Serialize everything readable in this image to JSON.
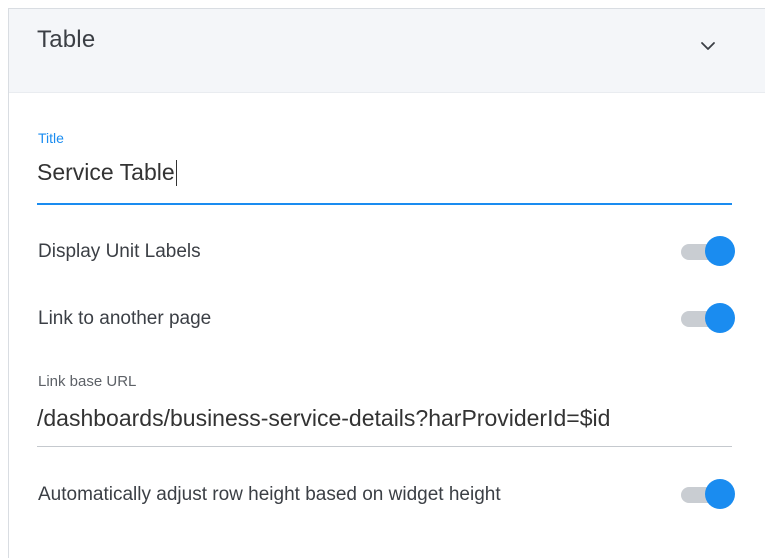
{
  "panel": {
    "title": "Table",
    "collapse_icon": "chevron-down-icon"
  },
  "title_field": {
    "label": "Title",
    "value": "Service Table"
  },
  "toggles": [
    {
      "label": "Display Unit Labels",
      "state": "on"
    },
    {
      "label": "Link to another page",
      "state": "on"
    },
    {
      "label": "Automatically adjust row height based on widget height",
      "state": "on"
    }
  ],
  "url_field": {
    "label": "Link base URL",
    "value": "/dashboards/business-service-details?harProviderId=$id"
  },
  "colors": {
    "accent": "#1a8cf0",
    "track": "#c9cdd2",
    "header_bg": "#f4f6f9"
  }
}
